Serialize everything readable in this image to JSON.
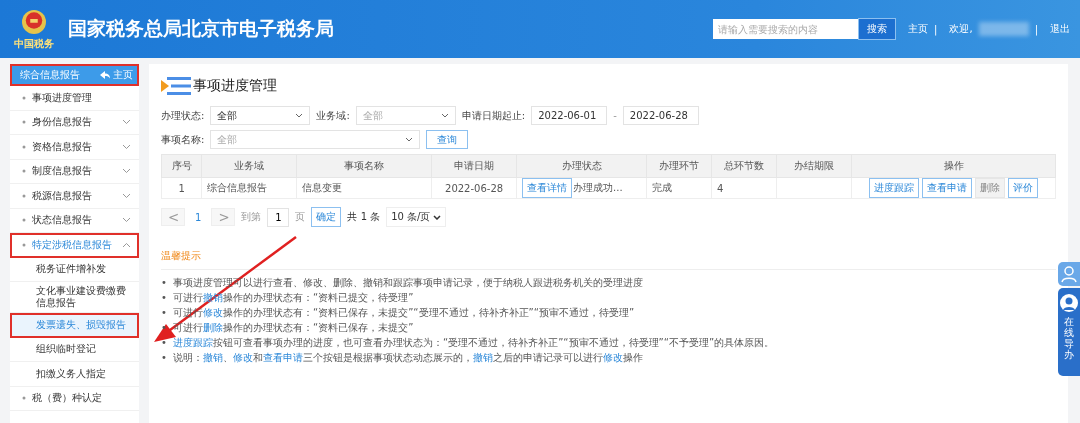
{
  "header": {
    "emblem_caption": "中国税务",
    "title": "国家税务总局北京市电子税务局",
    "search": {
      "placeholder": "请输入需要搜索的内容"
    },
    "search_button": "搜索",
    "home": "主页",
    "separator": "|",
    "welcome": "欢迎,",
    "logout": "退出"
  },
  "sidebar": {
    "header": {
      "label": "综合信息报告",
      "home": "主页",
      "highlighted": true
    },
    "items": [
      {
        "label": "事项进度管理",
        "kind": "leaf",
        "highlighted": false
      },
      {
        "label": "身份信息报告",
        "kind": "group",
        "expanded": false,
        "highlighted": false
      },
      {
        "label": "资格信息报告",
        "kind": "group",
        "expanded": false,
        "highlighted": false
      },
      {
        "label": "制度信息报告",
        "kind": "group",
        "expanded": false,
        "highlighted": false
      },
      {
        "label": "税源信息报告",
        "kind": "group",
        "expanded": false,
        "highlighted": false
      },
      {
        "label": "状态信息报告",
        "kind": "group",
        "expanded": false,
        "highlighted": false
      },
      {
        "label": "特定涉税信息报告",
        "kind": "group",
        "expanded": true,
        "highlighted": true,
        "children": [
          {
            "label": "税务证件增补发",
            "selected": false,
            "highlighted": false
          },
          {
            "label": "文化事业建设费缴费信息报告",
            "selected": false,
            "highlighted": false
          },
          {
            "label": "发票遗失、损毁报告",
            "selected": true,
            "highlighted": true
          },
          {
            "label": "组织临时登记",
            "selected": false,
            "highlighted": false
          },
          {
            "label": "扣缴义务人指定",
            "selected": false,
            "highlighted": false
          }
        ]
      },
      {
        "label": "税（费）种认定",
        "kind": "leaf",
        "highlighted": false
      }
    ]
  },
  "page": {
    "title": "事项进度管理",
    "filters": [
      {
        "label": "办理状态:",
        "value": "全部",
        "placeholder": false
      },
      {
        "label": "业务域:",
        "value": "全部",
        "placeholder": true
      }
    ],
    "date": {
      "label": "申请日期起止:",
      "from": "2022-06-01",
      "sep": "-",
      "to": "2022-06-28"
    },
    "name_filter": {
      "label": "事项名称:",
      "placeholder": "全部"
    },
    "query_button": "查询",
    "table": {
      "columns": [
        "序号",
        "业务域",
        "事项名称",
        "申请日期",
        "办理状态",
        "办理环节",
        "总环节数",
        "办结期限",
        "操作"
      ],
      "rows": [
        {
          "index": "1",
          "domain": "综合信息报告",
          "name": "信息变更",
          "date": "2022-06-28",
          "detail_button": "查看详情",
          "status": "办理成功...",
          "stage": "完成",
          "total": "4",
          "actions": [
            {
              "label": "进度跟踪",
              "disabled": false
            },
            {
              "label": "查看申请",
              "disabled": false
            },
            {
              "label": "删除",
              "disabled": true
            },
            {
              "label": "评价",
              "disabled": false
            }
          ]
        }
      ]
    },
    "pager": {
      "prev": "<",
      "page": "1",
      "next": ">",
      "goto": "到第",
      "goto_value": "1",
      "page_unit": "页",
      "confirm": "确定",
      "total": "共 1 条",
      "size": "10 条/页"
    },
    "tips": {
      "title": "温馨提示",
      "marker": "•",
      "items": [
        [
          {
            "text": "事项进度管理可以进行查看、修改、删除、撤销和跟踪事项申请记录，便于纳税人跟进税务机关的受理进度",
            "link": false
          }
        ],
        [
          {
            "text": "可进行",
            "link": false
          },
          {
            "text": "撤销",
            "link": true
          },
          {
            "text": "操作的办理状态有：“资料已提交，待受理”",
            "link": false
          }
        ],
        [
          {
            "text": "可进行",
            "link": false
          },
          {
            "text": "修改",
            "link": true
          },
          {
            "text": "操作的办理状态有：“资料已保存，未提交”“受理不通过，待补齐补正”“预审不通过，待受理”",
            "link": false
          }
        ],
        [
          {
            "text": "可进行",
            "link": false
          },
          {
            "text": "删除",
            "link": true
          },
          {
            "text": "操作的办理状态有：“资料已保存，未提交”",
            "link": false
          }
        ],
        [
          {
            "text": "进度跟踪",
            "link": true
          },
          {
            "text": "按钮可查看事项办理的进度，也可查看办理状态为：“受理不通过，待补齐补正”“预审不通过，待受理”“不予受理”的具体原因。",
            "link": false
          }
        ],
        [
          {
            "text": "说明：",
            "link": false
          },
          {
            "text": "撤销",
            "link": true
          },
          {
            "text": "、",
            "link": false
          },
          {
            "text": "修改",
            "link": true
          },
          {
            "text": "和",
            "link": false
          },
          {
            "text": "查看申请",
            "link": true
          },
          {
            "text": "三个按钮是根据事项状态动态展示的，",
            "link": false
          },
          {
            "text": "撤销",
            "link": true
          },
          {
            "text": "之后的申请记录可以进行",
            "link": false
          },
          {
            "text": "修改",
            "link": true
          },
          {
            "text": "操作",
            "link": false
          }
        ]
      ]
    }
  },
  "assistant": {
    "label": "在线导办"
  }
}
